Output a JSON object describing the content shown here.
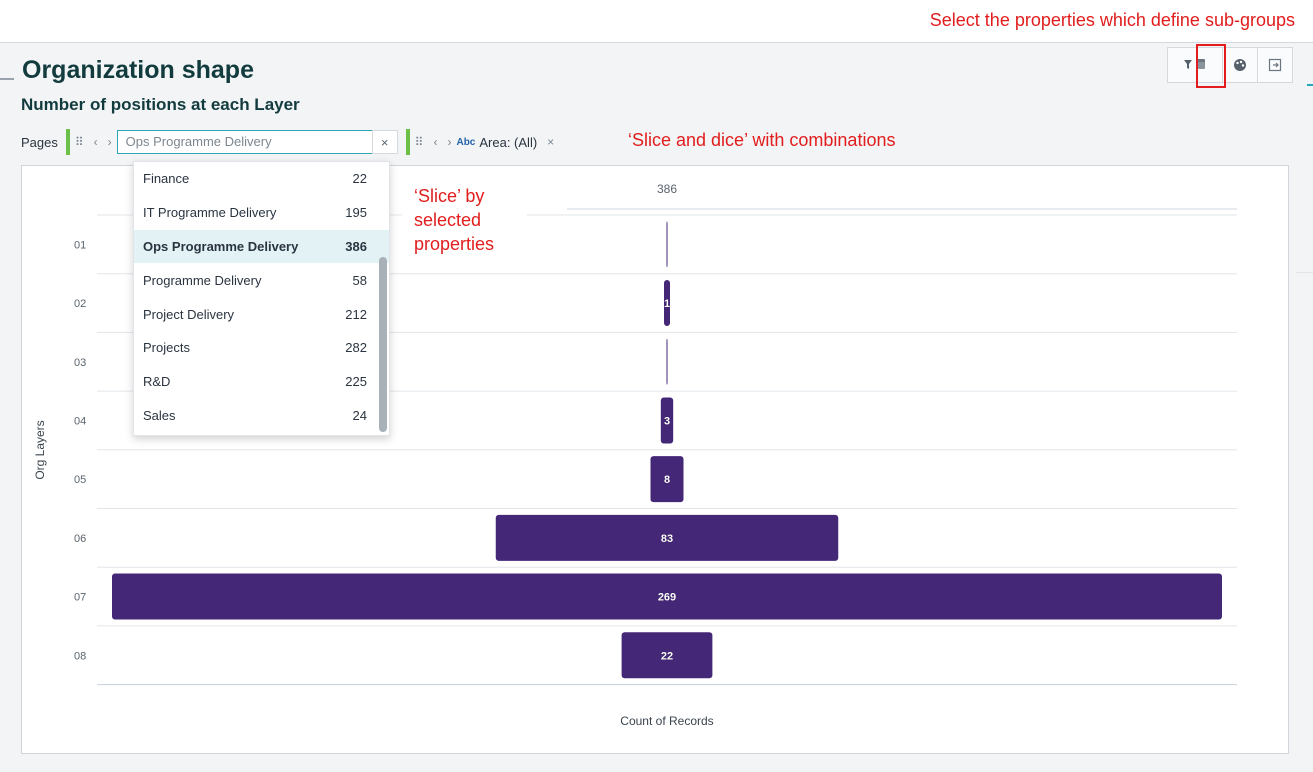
{
  "annotations": {
    "top": "Select the properties which define sub-groups",
    "combinations": "‘Slice and dice’ with combinations",
    "slice_lines": [
      "‘Slice’ by",
      "selected",
      "properties"
    ]
  },
  "header": {
    "title": "Organization shape",
    "subtitle": "Number of positions at each Layer"
  },
  "filters": {
    "pages_label": "Pages",
    "page_select_value": "Ops Programme Delivery",
    "clear": "×",
    "area_type_badge": "Abc",
    "area_label": "Area: (All)",
    "area_clear": "×"
  },
  "dropdown": {
    "items": [
      {
        "label": "Finance",
        "count": "22"
      },
      {
        "label": "IT Programme Delivery",
        "count": "195"
      },
      {
        "label": "Ops Programme Delivery",
        "count": "386",
        "selected": true
      },
      {
        "label": "Programme Delivery",
        "count": "58"
      },
      {
        "label": "Project Delivery",
        "count": "212"
      },
      {
        "label": "Projects",
        "count": "282"
      },
      {
        "label": "R&D",
        "count": "225"
      },
      {
        "label": "Sales",
        "count": "24"
      }
    ]
  },
  "toolbar": {
    "icons": [
      "filter-icon",
      "subgroup-icon",
      "palette-icon",
      "export-icon"
    ]
  },
  "colors": {
    "bar": "#452777",
    "accent": "#30a6b5",
    "annotation": "#e11d1d",
    "title": "#123b3e"
  },
  "chart_data": {
    "type": "bar",
    "orientation": "horizontal-centered",
    "top_label": "386",
    "ylabel": "Org Layers",
    "xlabel": "Count of Records",
    "categories": [
      "01",
      "02",
      "03",
      "04",
      "05",
      "06",
      "07",
      "08"
    ],
    "values": [
      0,
      1,
      0,
      3,
      8,
      83,
      269,
      22
    ],
    "value_labels": [
      "",
      "1",
      "",
      "3",
      "8",
      "83",
      "269",
      "22"
    ],
    "grid": true
  }
}
